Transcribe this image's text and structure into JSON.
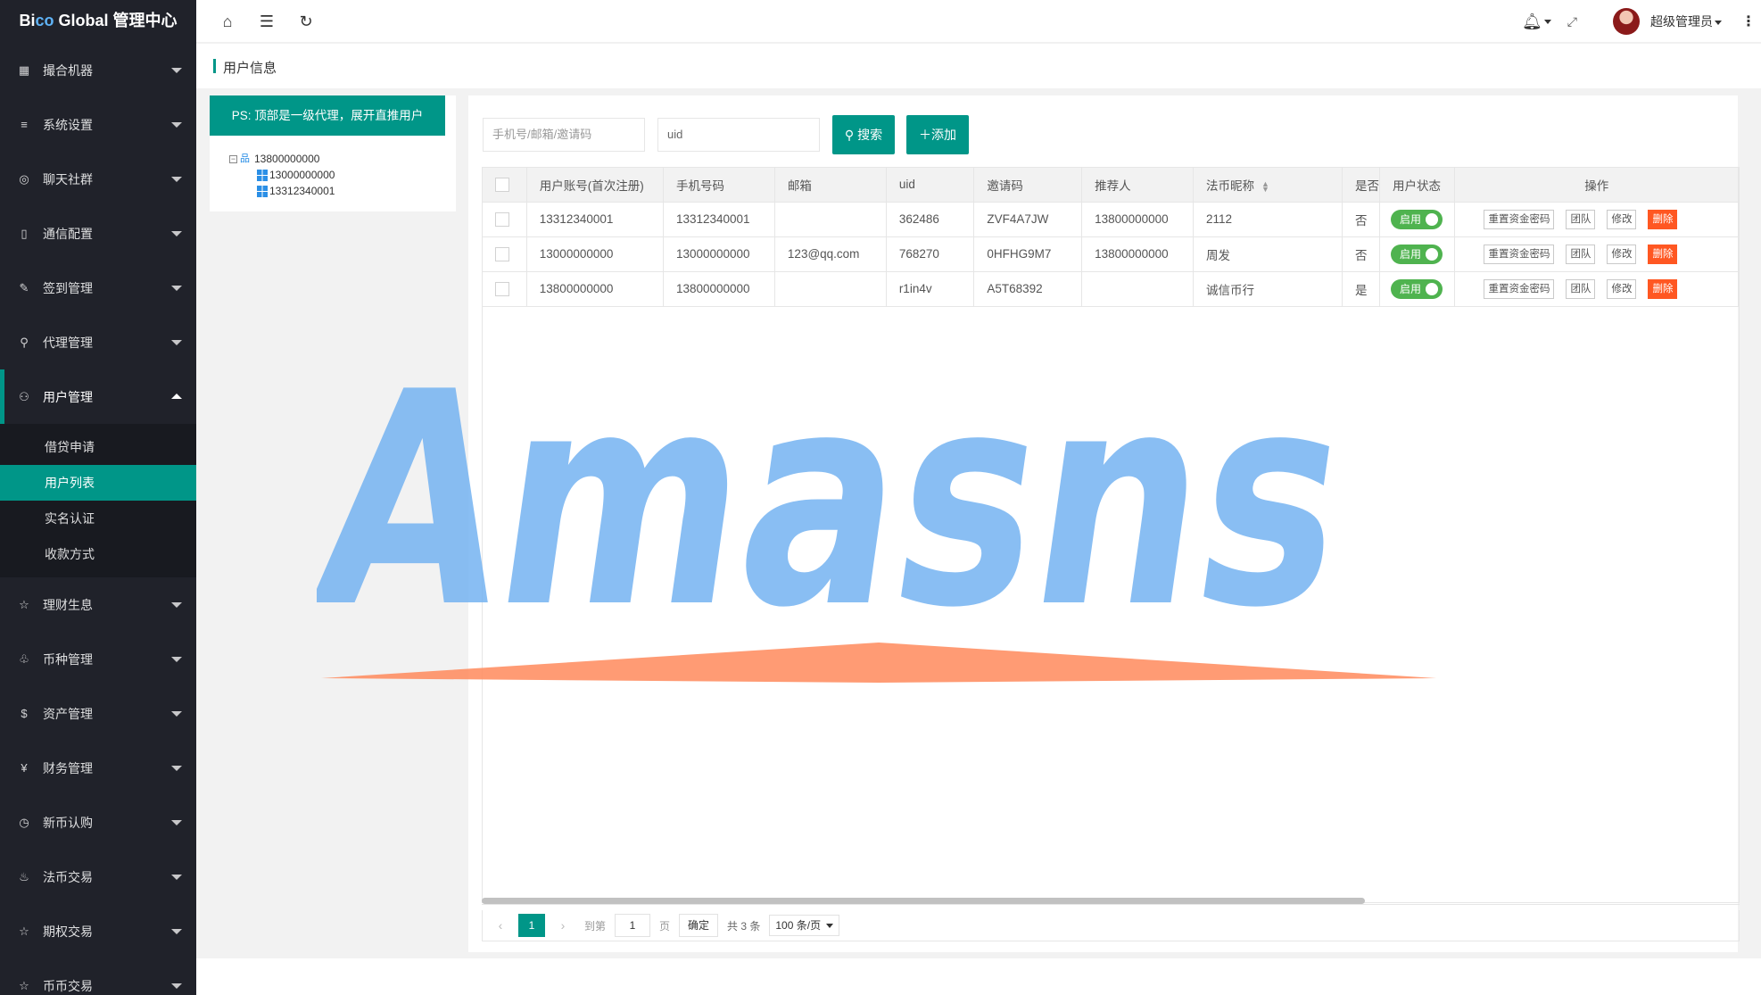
{
  "sidebar": {
    "logo_prefix": "Bi",
    "logo_accent": "co",
    "logo_suffix": " Global 管理中心",
    "items": [
      {
        "label": "撮合机器",
        "icon": "grid-icon"
      },
      {
        "label": "系统设置",
        "icon": "sliders-icon"
      },
      {
        "label": "聊天社群",
        "icon": "chat-icon"
      },
      {
        "label": "通信配置",
        "icon": "device-icon"
      },
      {
        "label": "签到管理",
        "icon": "edit-icon"
      },
      {
        "label": "代理管理",
        "icon": "user-icon"
      },
      {
        "label": "用户管理",
        "icon": "users-icon"
      }
    ],
    "sub_items": [
      {
        "label": "借贷申请"
      },
      {
        "label": "用户列表"
      },
      {
        "label": "实名认证"
      },
      {
        "label": "收款方式"
      }
    ],
    "items_after": [
      {
        "label": "理财生息",
        "icon": "star-icon"
      },
      {
        "label": "币种管理",
        "icon": "coins-icon"
      },
      {
        "label": "资产管理",
        "icon": "dollar-icon"
      },
      {
        "label": "财务管理",
        "icon": "yen-icon"
      },
      {
        "label": "新币认购",
        "icon": "clock-icon"
      },
      {
        "label": "法币交易",
        "icon": "fire-icon"
      },
      {
        "label": "期权交易",
        "icon": "star-icon"
      },
      {
        "label": "币币交易",
        "icon": "star-icon"
      }
    ]
  },
  "header": {
    "user_name": "超级管理员"
  },
  "page": {
    "title": "用户信息"
  },
  "left_panel": {
    "ps_button": "PS: 顶部是一级代理，展开直推用户",
    "tree_root": "13800000000",
    "tree_children": [
      "13000000000",
      "13312340001"
    ]
  },
  "search": {
    "keyword_placeholder": "手机号/邮箱/邀请码",
    "uid_value": "uid",
    "search_label": "搜索",
    "add_label": "添加"
  },
  "table": {
    "columns": [
      "用户账号(首次注册)",
      "手机号码",
      "邮箱",
      "uid",
      "邀请码",
      "推荐人",
      "法币昵称",
      "是否",
      "用户状态",
      "操作"
    ],
    "rows": [
      {
        "account": "13312340001",
        "phone": "13312340001",
        "email": "",
        "uid": "362486",
        "invite": "ZVF4A7JW",
        "referrer": "13800000000",
        "nickname": "2112",
        "flag": "否",
        "status": "启用"
      },
      {
        "account": "13000000000",
        "phone": "13000000000",
        "email": "123@qq.com",
        "uid": "768270",
        "invite": "0HFHG9M7",
        "referrer": "13800000000",
        "nickname": "周发",
        "flag": "否",
        "status": "启用"
      },
      {
        "account": "13800000000",
        "phone": "13800000000",
        "email": "",
        "uid": "r1in4v",
        "invite": "A5T68392",
        "referrer": "",
        "nickname": "诚信币行",
        "flag": "是",
        "status": "启用"
      }
    ],
    "actions": {
      "reset": "重置资金密码",
      "team": "团队",
      "edit": "修改",
      "delete": "删除"
    }
  },
  "pagination": {
    "current": "1",
    "goto_label": "到第",
    "goto_value": "1",
    "page_unit": "页",
    "confirm": "确定",
    "total": "共 3 条",
    "page_size": "100 条/页"
  },
  "watermark": {
    "text": "Amasns"
  },
  "colors": {
    "accent": "#009688",
    "sidebar": "#20222a",
    "danger": "#ff5722",
    "switch_on": "#4fb34f"
  }
}
